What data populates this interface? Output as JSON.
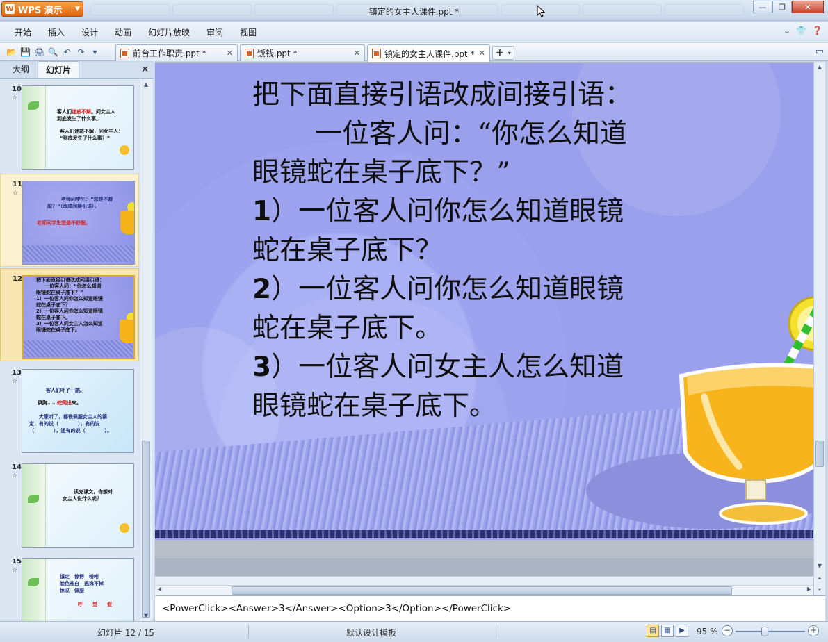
{
  "app": {
    "button_label": "WPS 演示",
    "window_title": "镇定的女主人课件.ppt *"
  },
  "menu": [
    "开始",
    "插入",
    "设计",
    "动画",
    "幻灯片放映",
    "审阅",
    "视图"
  ],
  "tabs": [
    {
      "label": "前台工作职责.ppt *"
    },
    {
      "label": "饭钱.ppt *"
    },
    {
      "label": "镇定的女主人课件.ppt *"
    }
  ],
  "left_panel": {
    "tabs": [
      "大纲",
      "幻灯片"
    ],
    "thumbnails": [
      {
        "number": "10",
        "lines": [
          "客人们",
          "迷惑不解",
          "。问女主人",
          "到底发生了什么事。",
          "客人们迷惑不解，问女主人：",
          "“到底发生了什么事？”"
        ]
      },
      {
        "number": "11",
        "lines": [
          "老师问学生：“您是不舒",
          "服？”（改成间接引语）。",
          "老师问学生您是不舒服。"
        ]
      },
      {
        "number": "12",
        "lines": [
          "把下面直接引语改成间接引语：",
          "一位客人问：“你怎么知道",
          "眼镜蛇在桌子底下？”",
          "1）一位客人问你怎么知道眼镜",
          "蛇在桌子底下？",
          "2）一位客人问你怎么知道眼镜",
          "蛇在桌子底下。",
          "3）一位客人问女主人怎么知道",
          "眼镜蛇在桌子底下。"
        ]
      },
      {
        "number": "13",
        "lines": [
          "客人们吓了一跳。",
          "俱胸",
          "蛇爬出",
          "来。",
          "大家听了，都很佩服女主人的镇",
          "定，有的说（　　　　），有的说",
          "（　　　　），还有的说（　　　　）。"
        ]
      },
      {
        "number": "14",
        "lines": [
          "读完课文，你想对",
          "女主人说什么呢？"
        ]
      },
      {
        "number": "15",
        "lines": [
          "镇定　惊愕　吩咐",
          "脸色苍白　逃逸不掉",
          "惊叹　佩服",
          "呼　　觉　　假"
        ]
      }
    ]
  },
  "slide": {
    "line1": "把下面直接引语改成间接引语：",
    "line2": "一位客人问：“你怎么知道",
    "line3": "眼镜蛇在桌子底下？”",
    "opt1_num": "1",
    "opt1_a": "）一位客人问你怎么知道眼镜",
    "opt1_b": "蛇在桌子底下？",
    "opt2_num": "2",
    "opt2_a": "）一位客人问你怎么知道眼镜",
    "opt2_b": "蛇在桌子底下。",
    "opt3_num": "3",
    "opt3_a": "）一位客人问女主人怎么知道",
    "opt3_b": "眼镜蛇在桌子底下。"
  },
  "notes": "<PowerClick><Answer>3</Answer><Option>3</Option></PowerClick>",
  "status": {
    "slide_counter": "幻灯片 12 / 15",
    "template": "默认设计模板",
    "zoom": "95 %"
  }
}
